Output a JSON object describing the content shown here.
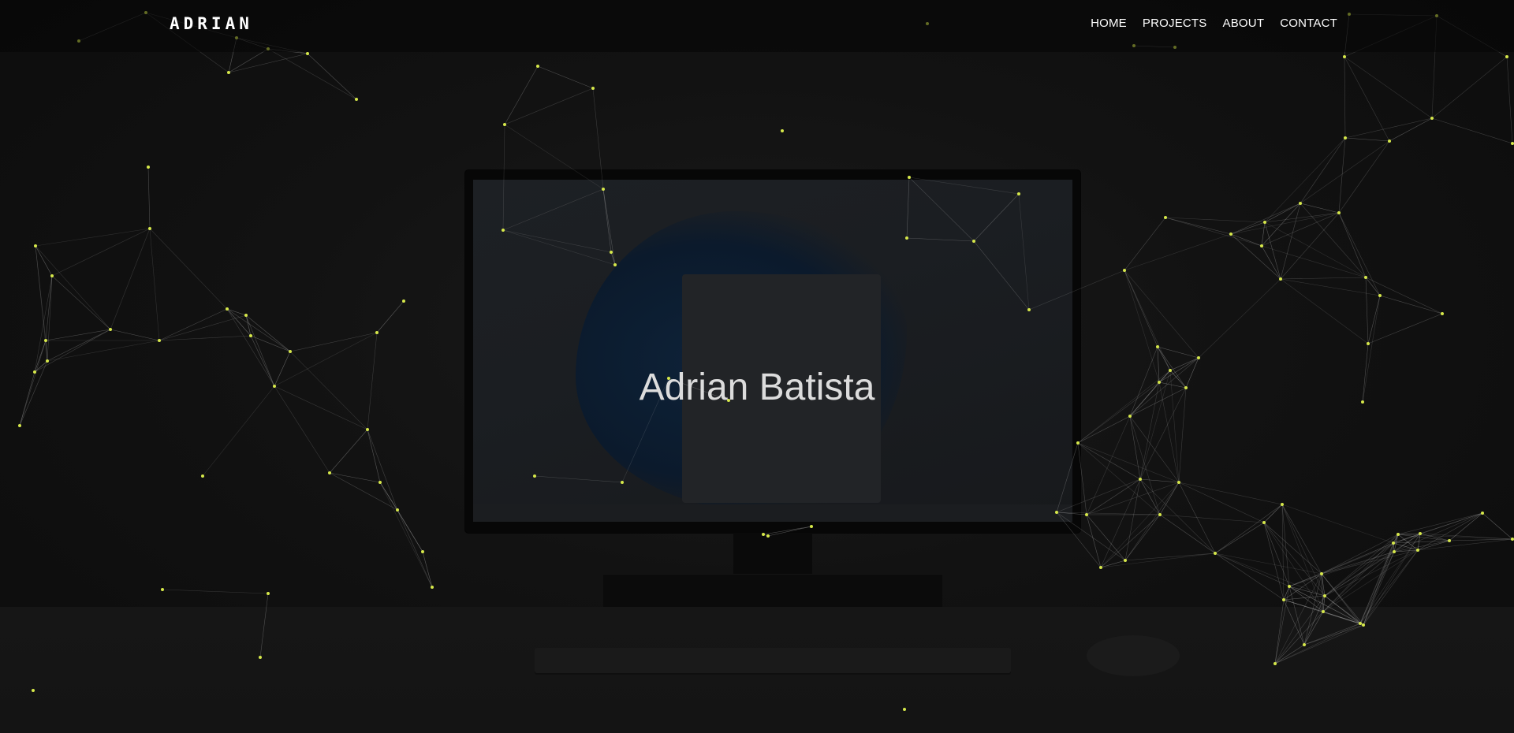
{
  "brand": {
    "logo": "ADRIAN"
  },
  "nav": {
    "items": [
      {
        "label": "HOME"
      },
      {
        "label": "PROJECTS"
      },
      {
        "label": "ABOUT"
      },
      {
        "label": "CONTACT"
      }
    ]
  },
  "hero": {
    "title": "Adrian Batista"
  },
  "colors": {
    "background": "#0e0e0e",
    "particle": "#d6e84a",
    "link_line": "#bdbdbd",
    "text": "#ffffff"
  },
  "icons": [
    "particle-network-background"
  ]
}
